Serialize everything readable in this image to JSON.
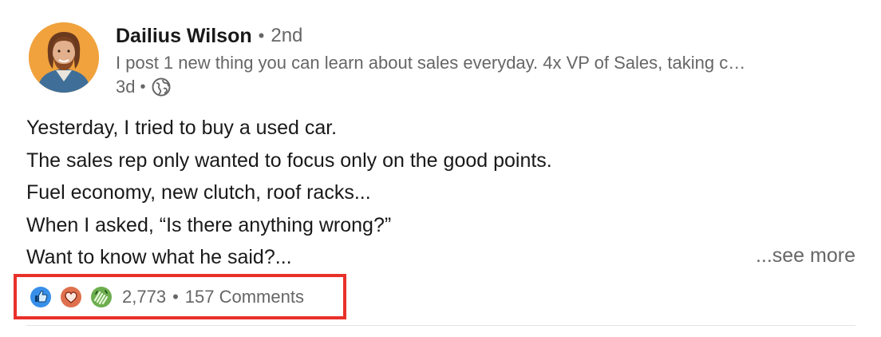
{
  "author": {
    "name": "Dailius Wilson",
    "separator": "•",
    "degree": "2nd",
    "headline": "I post 1 new thing you can learn about sales everyday. 4x VP of Sales, taking c…",
    "time": "3d",
    "visibility_icon": "globe-icon"
  },
  "post": {
    "lines": [
      "Yesterday, I tried to buy a used car.",
      "The sales rep only wanted to focus only on the good points.",
      "Fuel economy, new clutch, roof racks...",
      "When I asked, “Is there anything wrong?”",
      "Want to know what he said?..."
    ],
    "see_more": "...see more"
  },
  "social": {
    "reaction_icons": [
      "like-icon",
      "love-icon",
      "celebrate-icon"
    ],
    "reaction_count": "2,773",
    "separator": "•",
    "comments": "157 Comments",
    "highlight_color": "#e8312a"
  }
}
